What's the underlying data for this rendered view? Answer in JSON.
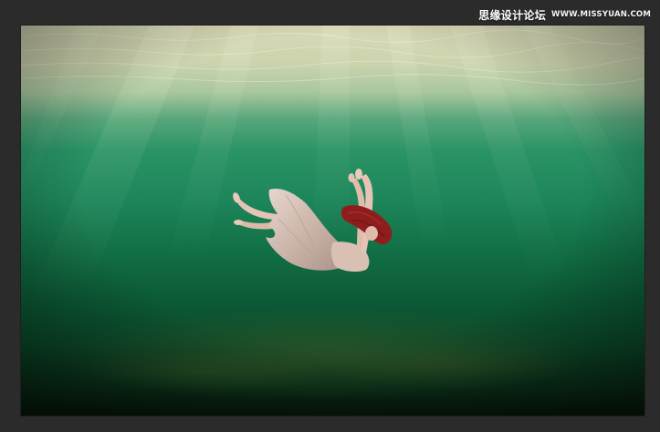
{
  "watermark": {
    "site_name_cn": "思缘设计论坛",
    "site_url": "WWW.MISSYUAN.COM"
  },
  "canvas": {
    "background_colors": {
      "surface": "#d8d9b6",
      "water_top": "#2a9466",
      "water_mid": "#126f45",
      "water_deep": "#0b4a2a",
      "floor": "#071709",
      "frame": "#2b2b2b"
    },
    "subject": {
      "icon": "falling-woman-figure",
      "dress_color": "#cbb5aa",
      "hair_color": "#8e1e1e",
      "skin_color": "#e6c4b5"
    }
  }
}
